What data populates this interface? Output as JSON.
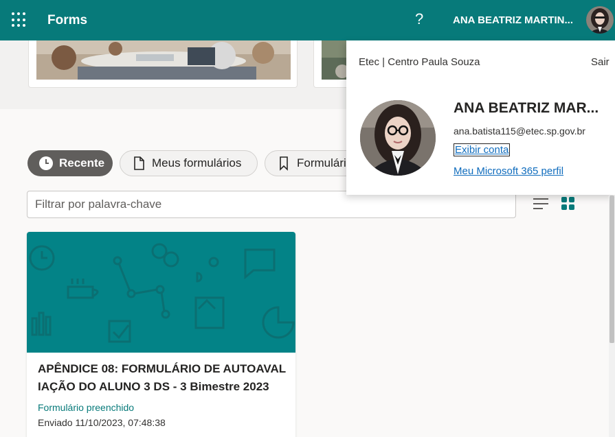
{
  "header": {
    "app_title": "Forms",
    "help_symbol": "?",
    "user_name": "ANA BEATRIZ MARTIN...",
    "waffle_icon": "app-launcher-icon",
    "bg_color": "#077a7a"
  },
  "tabs": [
    {
      "label": "Recente",
      "icon": "clock-icon",
      "active": true
    },
    {
      "label": "Meus formulários",
      "icon": "document-icon",
      "active": false
    },
    {
      "label": "Formulários",
      "icon": "bookmark-icon",
      "active": false
    }
  ],
  "filter": {
    "placeholder": "Filtrar por palavra-chave"
  },
  "view_toggle": {
    "list_icon": "list-view-icon",
    "grid_icon": "grid-view-icon",
    "selected": "grid"
  },
  "form_card": {
    "title": "APÊNDICE 08: FORMULÁRIO DE AUTOAVALIAÇÃO DO ALUNO 3 DS - 3 Bimestre 2023",
    "status": "Formulário preenchido",
    "sent": "Enviado 11/10/2023, 07:48:38",
    "banner_color": "#038387"
  },
  "account_panel": {
    "org": "Etec | Centro Paula Souza",
    "sign_out": "Sair",
    "name": "ANA BEATRIZ MAR...",
    "email": "ana.batista115@etec.sp.gov.br",
    "view_account": "Exibir conta",
    "m365_profile": "Meu Microsoft 365 perfil"
  }
}
